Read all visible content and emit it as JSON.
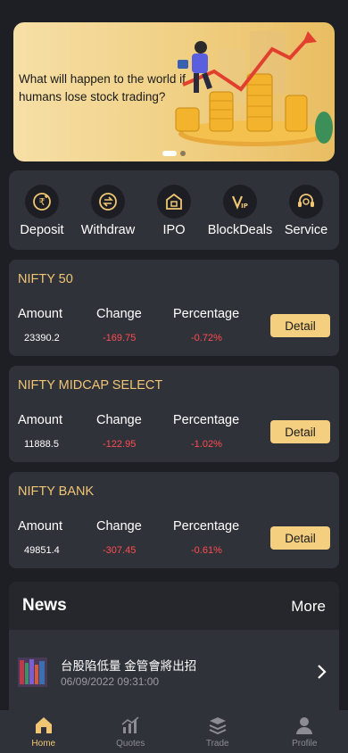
{
  "banner": {
    "headline": "What will happen to the world if humans lose stock trading?",
    "slide_count": 2,
    "active_slide": 1
  },
  "quick_menu": [
    {
      "label": "Deposit",
      "icon": "deposit-icon"
    },
    {
      "label": "Withdraw",
      "icon": "withdraw-icon"
    },
    {
      "label": "IPO",
      "icon": "ipo-icon"
    },
    {
      "label": "BlockDeals",
      "icon": "vip-icon"
    },
    {
      "label": "Service",
      "icon": "headset-icon"
    }
  ],
  "indices": [
    {
      "name": "NIFTY 50",
      "amount": "23390.2",
      "change": "-169.75",
      "percentage": "-0.72%"
    },
    {
      "name": "NIFTY MIDCAP SELECT",
      "amount": "11888.5",
      "change": "-122.95",
      "percentage": "-1.02%"
    },
    {
      "name": "NIFTY BANK",
      "amount": "49851.4",
      "change": "-307.45",
      "percentage": "-0.61%"
    }
  ],
  "columns": {
    "amount": "Amount",
    "change": "Change",
    "percentage": "Percentage"
  },
  "detail_label": "Detail",
  "news": {
    "title": "News",
    "more_label": "More",
    "items": [
      {
        "headline": "台股陷低量 金管會將出招",
        "date": "06/09/2022 09:31:00"
      }
    ]
  },
  "tabs": [
    {
      "label": "Home",
      "icon": "home-icon",
      "active": true
    },
    {
      "label": "Quotes",
      "icon": "chart-icon",
      "active": false
    },
    {
      "label": "Trade",
      "icon": "layers-icon",
      "active": false
    },
    {
      "label": "Profile",
      "icon": "user-icon",
      "active": false
    }
  ],
  "colors": {
    "accent": "#f0c674",
    "negative": "#ff4d4f",
    "card": "#30323a",
    "background": "#1e1f24"
  }
}
